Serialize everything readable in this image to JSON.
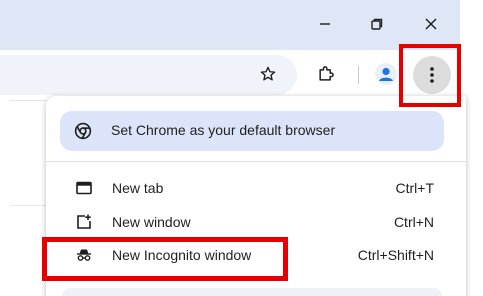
{
  "window_controls": {
    "minimize_icon": "minimize-icon",
    "restore_icon": "restore-icon",
    "close_icon": "close-icon"
  },
  "toolbar": {
    "bookmark_icon": "star-icon",
    "extensions_icon": "puzzle-icon",
    "profile_icon": "profile-avatar-icon",
    "menu_icon": "three-dot-menu-icon"
  },
  "menu": {
    "default_banner": {
      "icon": "chrome-logo-icon",
      "label": "Set Chrome as your default browser"
    },
    "items": [
      {
        "icon": "new-tab-icon",
        "label": "New tab",
        "shortcut": "Ctrl+T"
      },
      {
        "icon": "new-window-icon",
        "label": "New window",
        "shortcut": "Ctrl+N"
      },
      {
        "icon": "incognito-icon",
        "label": "New Incognito window",
        "shortcut": "Ctrl+Shift+N"
      }
    ]
  },
  "colors": {
    "titlebar": "#dfe7f7",
    "banner": "#dbe4f8",
    "highlight": "#e60000",
    "profile": "#1a73e8"
  }
}
